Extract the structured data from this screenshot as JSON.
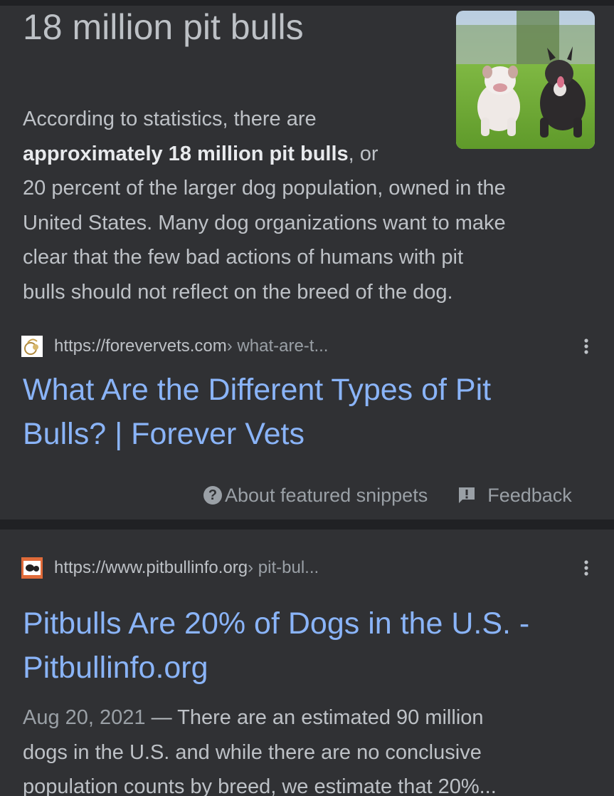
{
  "featured_snippet": {
    "answer_title": "18 million pit bulls",
    "image_alt": "two pit bull dogs sitting on grass",
    "snippet": {
      "line1": "According to statistics, there are",
      "line2_bold": "approximately 18 million pit bulls",
      "line2_rest": ", or",
      "line3": "20 percent of the larger dog population, owned in the",
      "line4": "United States. Many dog organizations want to make",
      "line5": "clear that the few bad actions of humans with pit",
      "line6": "bulls should not reflect on the breed of the dog."
    },
    "source": {
      "url_host": "https://forevervets.com",
      "url_path": " › what-are-t...",
      "favicon": "forevervets-favicon"
    },
    "title_line1": "What Are the Different Types of Pit",
    "title_line2": "Bulls? | Forever Vets",
    "footer": {
      "about_label": "About featured snippets",
      "feedback_label": "Feedback"
    }
  },
  "result": {
    "source": {
      "url_host": "https://www.pitbullinfo.org",
      "url_path": " › pit-bul...",
      "favicon": "pitbullinfo-favicon"
    },
    "title_line1": "Pitbulls Are 20% of Dogs in the U.S. -",
    "title_line2": "Pitbullinfo.org",
    "date": "Aug 20, 2021",
    "snippet_line1": " — There are an estimated 90 million",
    "snippet_line2": "dogs in the U.S. and while there are no conclusive",
    "snippet_line3": "population counts by breed, we estimate that 20%..."
  },
  "colors": {
    "background": "#303134",
    "separator": "#202124",
    "link": "#8ab4f8",
    "text": "#bdc1c6",
    "muted": "#9aa0a6"
  }
}
